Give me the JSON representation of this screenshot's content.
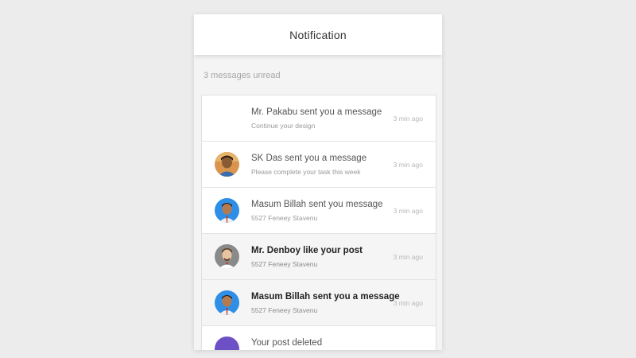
{
  "header": {
    "title": "Notification"
  },
  "summary": {
    "unread_text": "3 messages unread"
  },
  "notifications": [
    {
      "message": "Mr. Pakabu sent you a message",
      "detail": "Continue your design",
      "time": "3 min ago",
      "avatar": "none",
      "read": false
    },
    {
      "message": "SK Das sent you a message",
      "detail": "Please complete your task this week",
      "time": "3 min ago",
      "avatar": "sk-das-avatar",
      "read": false
    },
    {
      "message": "Masum Billah sent you message",
      "detail": "5527 Feneey Stavenu",
      "time": "3 min ago",
      "avatar": "masum-billah-avatar",
      "read": false
    },
    {
      "message": "Mr. Denboy like your post",
      "detail": "5527 Feneey Stavenu",
      "time": "3 min ago",
      "avatar": "mr-denboy-avatar",
      "read": true
    },
    {
      "message": "Masum Billah sent you a message",
      "detail": "5527 Feneey Stavenu",
      "time": "3 min ago",
      "avatar": "masum-billah-avatar",
      "read": true
    },
    {
      "message": "Your post deleted",
      "detail": "",
      "time": "",
      "avatar": "purple-avatar",
      "read": false
    }
  ],
  "colors": {
    "background": "#ececec",
    "panel": "#f4f4f4",
    "read_row": "#f5f5f5",
    "avatar_blue": "#2f8fe6",
    "avatar_orange": "#d9954e",
    "avatar_gray": "#8a8a8a",
    "avatar_purple": "#6d4fc6"
  }
}
